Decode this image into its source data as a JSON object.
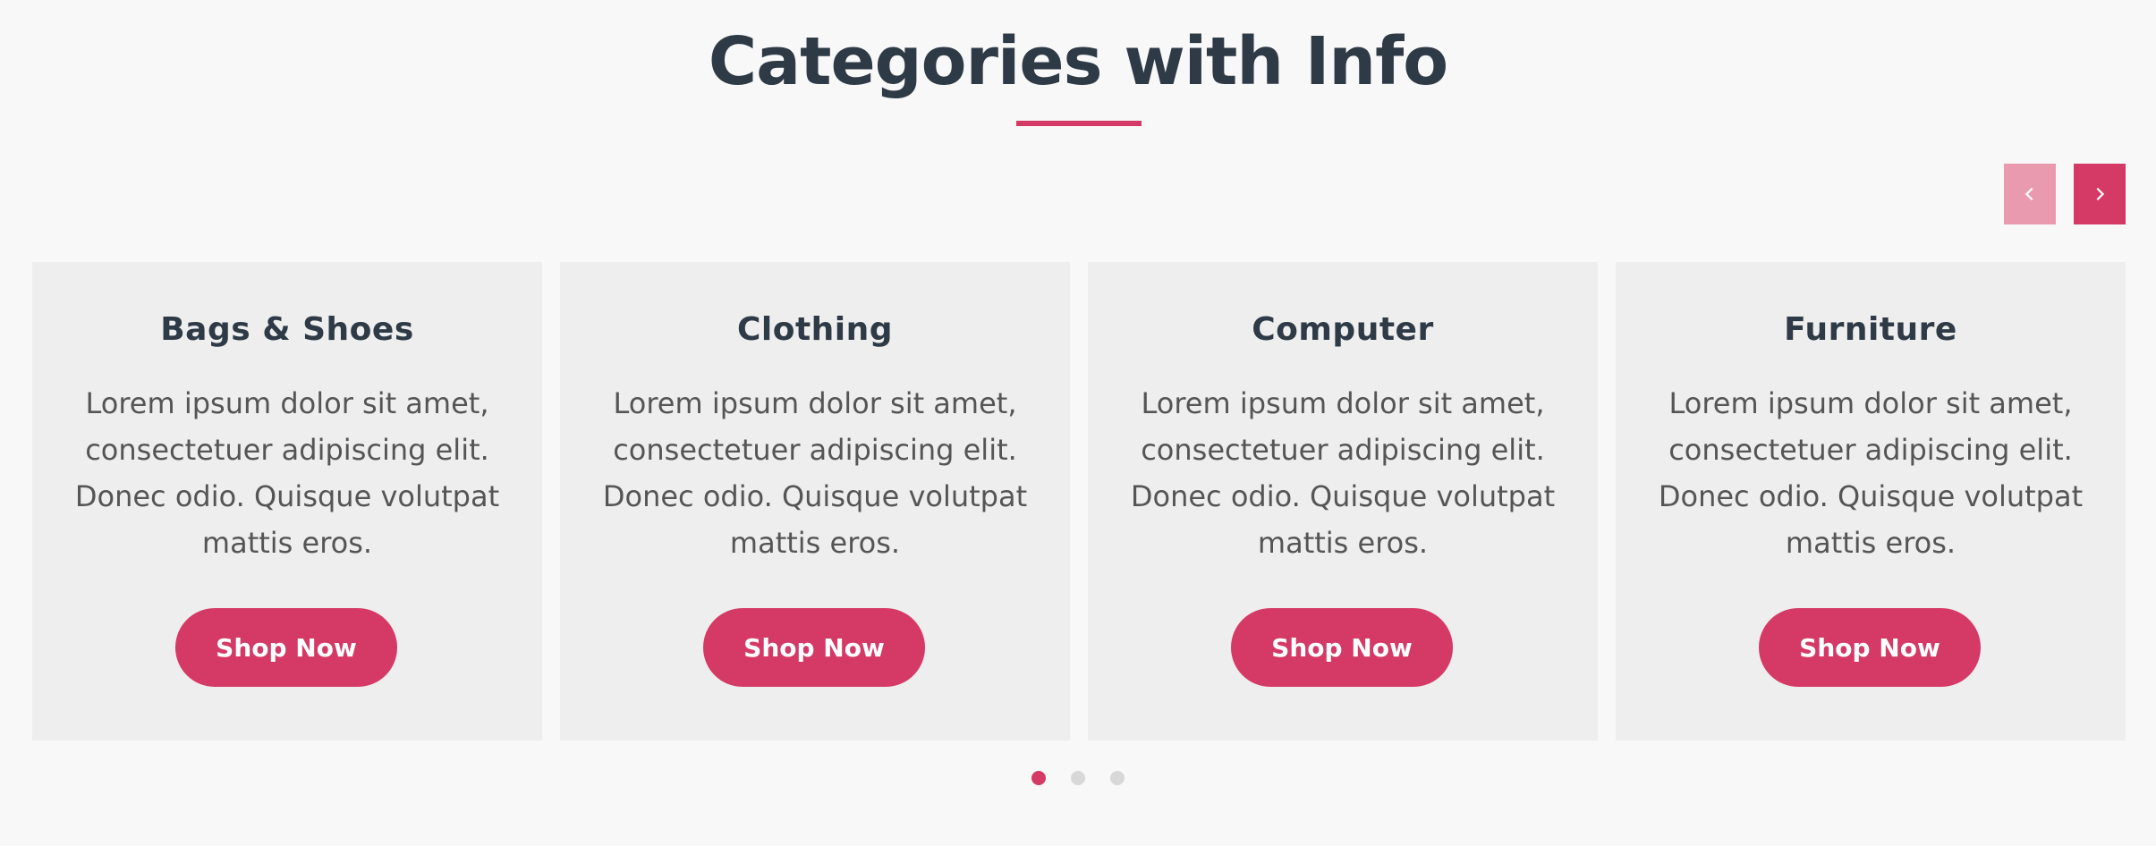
{
  "section": {
    "title": "Categories with Info"
  },
  "carousel": {
    "prev_icon": "chevron-left-icon",
    "next_icon": "chevron-right-icon",
    "cards": [
      {
        "title": "Bags & Shoes",
        "text": "Lorem ipsum dolor sit amet, consectetuer adipiscing elit. Donec odio. Quisque volutpat mattis eros.",
        "button": "Shop Now"
      },
      {
        "title": "Clothing",
        "text": "Lorem ipsum dolor sit amet, consectetuer adipiscing elit. Donec odio. Quisque volutpat mattis eros.",
        "button": "Shop Now"
      },
      {
        "title": "Computer",
        "text": "Lorem ipsum dolor sit amet, consectetuer adipiscing elit. Donec odio. Quisque volutpat mattis eros.",
        "button": "Shop Now"
      },
      {
        "title": "Furniture",
        "text": "Lorem ipsum dolor sit amet, consectetuer adipiscing elit. Donec odio. Quisque volutpat mattis eros.",
        "button": "Shop Now"
      }
    ],
    "dots": {
      "count": 3,
      "active": 1
    }
  },
  "colors": {
    "accent": "#d53966",
    "accent_light": "#e99aaf",
    "heading": "#2f3a47",
    "body_text": "#555555",
    "card_bg": "#eeeeee",
    "page_bg": "#f8f8f8",
    "dot_inactive": "#d8d8d8"
  }
}
